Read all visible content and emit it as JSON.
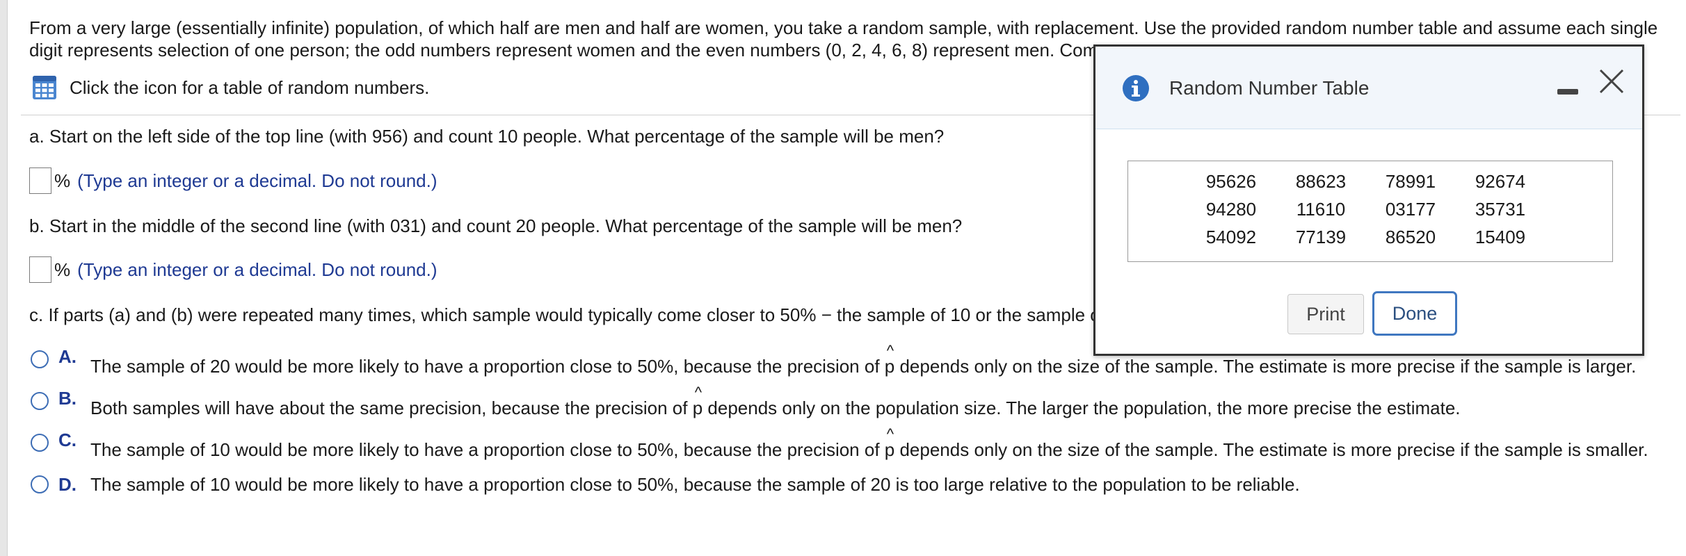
{
  "intro": {
    "line1": "From a very large (essentially infinite) population, of which half are men and half are women, you take a random sample, with replacement. Use the provided random number table and assume each single",
    "line2": "digit represents selection of one person; the odd numbers represent women and the even numbers (0, 2, 4, 6, 8) represent men. Com"
  },
  "table_link": {
    "label": "Click the icon for a table of random numbers.",
    "icon": "grid-table-icon"
  },
  "part_a": {
    "question": "a. Start on the left side of the top line (with 956) and count 10 people. What percentage of the sample will be men?",
    "answer_value": "",
    "unit": "%",
    "hint": "(Type an integer or a decimal. Do not round.)"
  },
  "part_b": {
    "question": "b. Start in the middle of the second line (with 031) and count 20 people. What percentage of the sample will be men?",
    "answer_value": "",
    "unit": "%",
    "hint": "(Type an integer or a decimal. Do not round.)"
  },
  "part_c": {
    "question": "c. If parts (a) and (b) were repeated many times, which sample would typically come closer to 50% − the sample of 10 or the sample o",
    "choices": [
      {
        "letter": "A.",
        "before": "The sample of 20 would be more likely to have a proportion close to 50%, because the precision of ",
        "phat": "p",
        "after": " depends only on the size of the sample. The estimate is more precise if the sample is larger."
      },
      {
        "letter": "B.",
        "before": "Both samples will have about the same precision, because the precision of ",
        "phat": "p",
        "after": " depends only on the population size. The larger the population, the more precise the estimate."
      },
      {
        "letter": "C.",
        "before": "The sample of 10 would be more likely to have a proportion close to 50%, because the precision of ",
        "phat": "p",
        "after": " depends only on the size of the sample. The estimate is more precise if the sample is smaller."
      },
      {
        "letter": "D.",
        "text": "The sample of 10 would be more likely to have a proportion close to 50%, because the sample of 20 is too large relative to the population to be reliable."
      }
    ]
  },
  "modal": {
    "title": "Random Number Table",
    "icon": "info-icon",
    "rows": [
      [
        "95626",
        "88623",
        "78991",
        "92674"
      ],
      [
        "94280",
        "11610",
        "03177",
        "35731"
      ],
      [
        "54092",
        "77139",
        "86520",
        "15409"
      ]
    ],
    "print_label": "Print",
    "done_label": "Done"
  },
  "colors": {
    "accent": "#3f77c0",
    "hint_text": "#1f3a93",
    "modal_header_bg": "#f2f6fb"
  }
}
